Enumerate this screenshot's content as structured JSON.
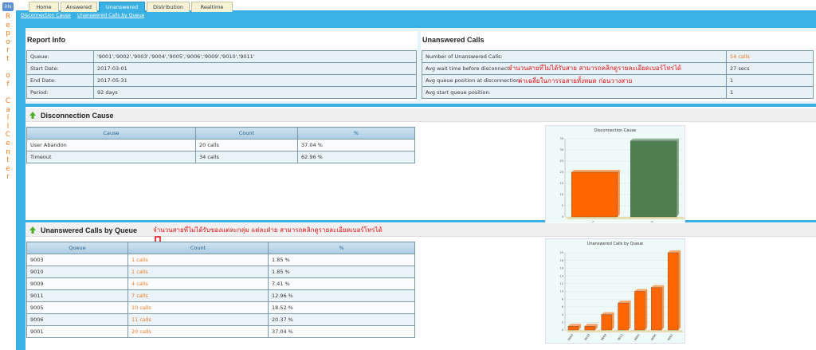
{
  "sidebar": {
    "logo": "iris",
    "title_chars": [
      "R",
      "e",
      "p",
      "o",
      "r",
      "t",
      " ",
      "o",
      "f",
      " ",
      "C",
      "a",
      "l",
      "l",
      "C",
      "e",
      "n",
      "t",
      "e",
      "r"
    ]
  },
  "tabs": [
    {
      "label": "Home"
    },
    {
      "label": "Answered"
    },
    {
      "label": "Unanswered"
    },
    {
      "label": "Distribution"
    },
    {
      "label": "Realtime"
    }
  ],
  "breadcrumb": [
    "Disconnection Cause",
    "Unanswered Calls by Queue"
  ],
  "report_info": {
    "title": "Report Info",
    "rows": [
      {
        "label": "Queue:",
        "value": "'9001','9002','9003','9004','9005','9006','9009','9010','9011'"
      },
      {
        "label": "Start Date:",
        "value": "2017-03-01"
      },
      {
        "label": "End Date:",
        "value": "2017-05-31"
      },
      {
        "label": "Period:",
        "value": "92 days"
      }
    ]
  },
  "unanswered": {
    "title": "Unanswered Calls",
    "rows": [
      {
        "label": "Number of Unanswered Calls:",
        "value": "54 calls"
      },
      {
        "label": "Avg wait time before disconnect:",
        "value": "27 secs"
      },
      {
        "label": "Avg queue position at disconnection:",
        "value": "1"
      },
      {
        "label": "Avg start queue position:",
        "value": "1"
      }
    ],
    "note1": "จำนวนสายที่ไม่ได้รับสาย สามารถคลิกดูรายละเอียดเบอร์โทรได้",
    "note2": "ค่าเฉลี่ยในการรอสายทั้งหมด ก่อนวางสาย"
  },
  "disconnection": {
    "title": "Disconnection Cause",
    "headers": [
      "Cause",
      "Count",
      "%"
    ],
    "rows": [
      [
        "User Abandon",
        "20 calls",
        "37.04 %"
      ],
      [
        "Timeout",
        "34 calls",
        "62.96 %"
      ]
    ]
  },
  "by_queue": {
    "title": "Unanswered Calls by Queue",
    "note": "จำนวนสายที่ไม่ได้รับของแต่ละกลุ่ม แต่ละฝ่าย สามารถคลิกดูรายละเอียดเบอร์โทรได้",
    "headers": [
      "Queue",
      "Count",
      "%"
    ],
    "rows": [
      [
        "9003",
        "1 calls",
        "1.85 %"
      ],
      [
        "9010",
        "1 calls",
        "1.85 %"
      ],
      [
        "9009",
        "4 calls",
        "7.41 %"
      ],
      [
        "9011",
        "7 calls",
        "12.96 %"
      ],
      [
        "9005",
        "10 calls",
        "18.52 %"
      ],
      [
        "9006",
        "11 calls",
        "20.37 %"
      ],
      [
        "9001",
        "20 calls",
        "37.04 %"
      ]
    ]
  },
  "chart_data": [
    {
      "type": "bar",
      "title": "Disconnection Cause",
      "categories": [
        "Abandon",
        "Timeout"
      ],
      "values": [
        20,
        34
      ],
      "colors": [
        "#ff6600",
        "#4f7f4f"
      ],
      "ylim": [
        0,
        35
      ],
      "yticks": [
        "0",
        "5",
        "10",
        "15",
        "20",
        "25",
        "30",
        "35"
      ]
    },
    {
      "type": "bar",
      "title": "Unanswered Calls by Queue",
      "categories": [
        "9003",
        "9010",
        "9009",
        "9011",
        "9005",
        "9006",
        "9001"
      ],
      "values": [
        1,
        1,
        4,
        7,
        10,
        11,
        20
      ],
      "colors": [
        "#ff6600"
      ],
      "ylim": [
        0,
        20
      ],
      "yticks": [
        "0",
        "2",
        "4",
        "6",
        "8",
        "10",
        "12",
        "14",
        "16",
        "18",
        "20"
      ]
    }
  ]
}
